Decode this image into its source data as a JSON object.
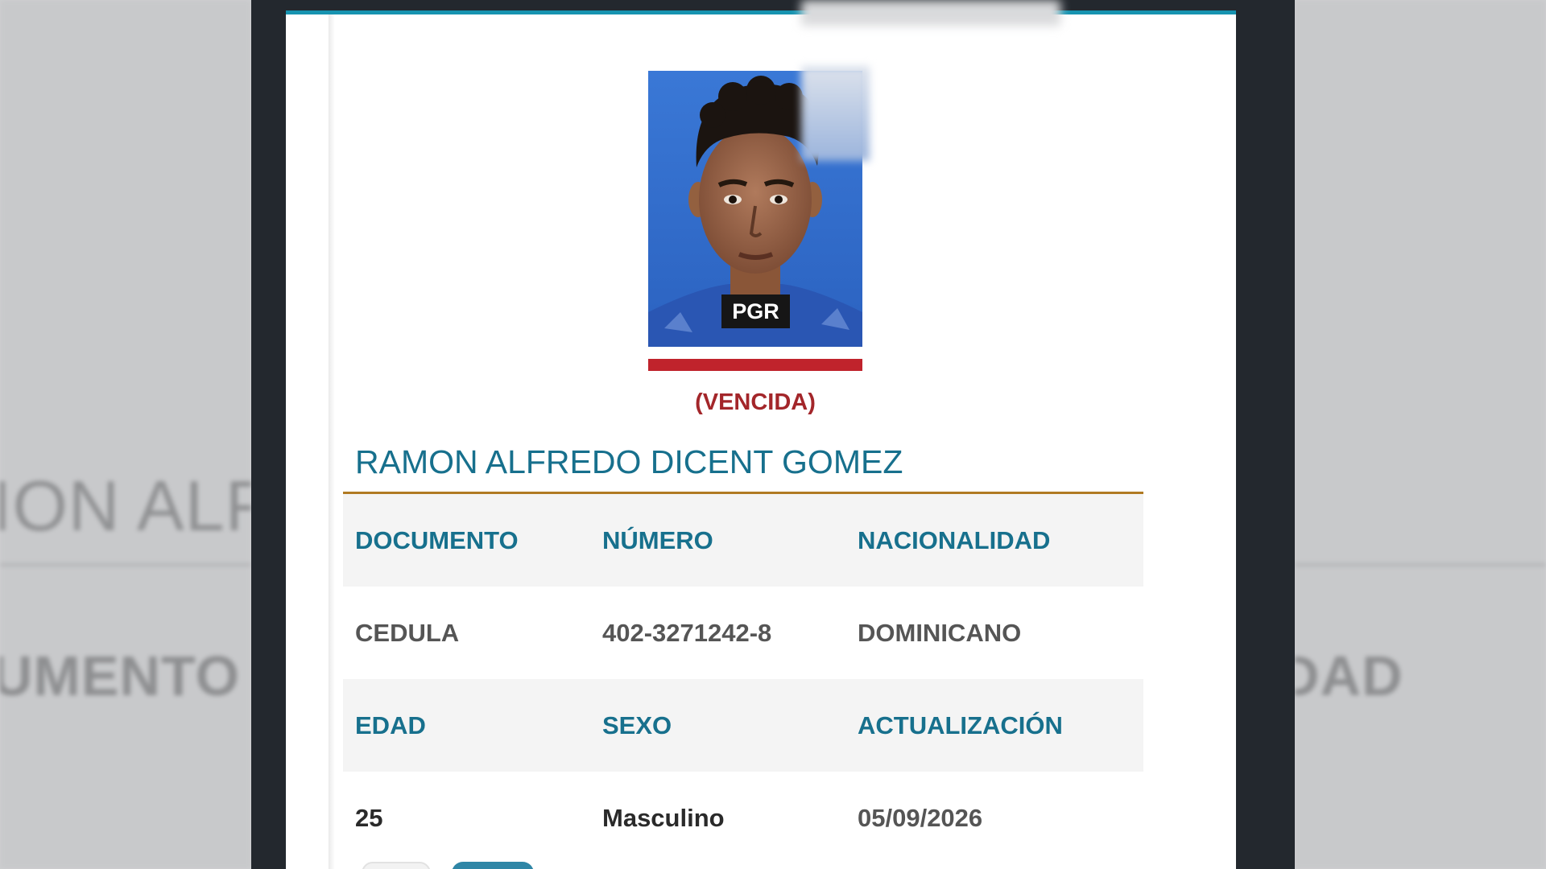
{
  "record": {
    "watermark": "PGR",
    "status": "(VENCIDA)",
    "full_name": "RAMON ALFREDO DICENT GOMEZ"
  },
  "table": {
    "row1_headers": [
      "DOCUMENTO",
      "NÚMERO",
      "NACIONALIDAD"
    ],
    "row1_values": [
      "CEDULA",
      "402-3271242-8",
      "DOMINICANO"
    ],
    "row2_headers": [
      "EDAD",
      "SEXO",
      "ACTUALIZACIÓN"
    ],
    "row2_values": [
      "25",
      "Masculino",
      "05/09/2026"
    ]
  },
  "background": {
    "name_fragment": "ION ALF",
    "doc_fragment": "UMENTO",
    "nat_fragment": "DAD"
  },
  "colors": {
    "accent_teal": "#17708d",
    "top_border": "#1793b0",
    "status_red": "#c0232c",
    "rule_gold": "#b07a22"
  }
}
